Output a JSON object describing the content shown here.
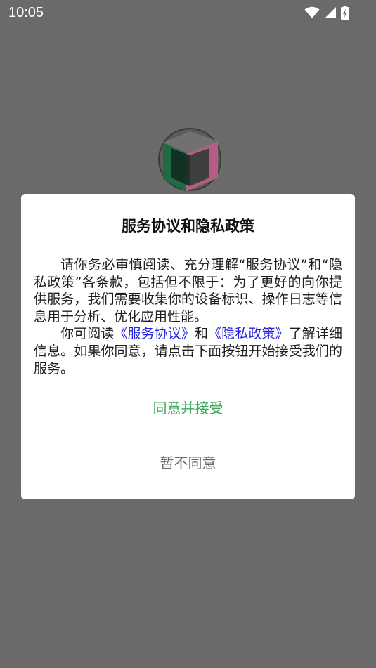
{
  "status_bar": {
    "time": "10:05",
    "icons": [
      "wifi-icon",
      "signal-icon",
      "battery-charging-icon"
    ]
  },
  "dialog": {
    "title": "服务协议和隐私政策",
    "paragraph1": "请你务必审慎阅读、充分理解“服务协议”和“隐私政策”各条款，包括但不限于：为了更好的向你提供服务，我们需要收集你的设备标识、操作日志等信息用于分析、优化应用性能。",
    "paragraph2_prefix": "你可阅读",
    "service_agreement_link": "《服务协议》",
    "paragraph2_and": "和",
    "privacy_policy_link": "《隐私政策》",
    "paragraph2_suffix": "了解详细信息。如果你同意，请点击下面按钮开始接受我们的服务。",
    "agree_label": "同意并接受",
    "disagree_label": "暂不同意"
  },
  "colors": {
    "overlay": "#6a6a6a",
    "dialog_bg": "#ffffff",
    "agree": "#3aa858",
    "link": "#2424e0",
    "disagree": "#6a6a6a"
  }
}
